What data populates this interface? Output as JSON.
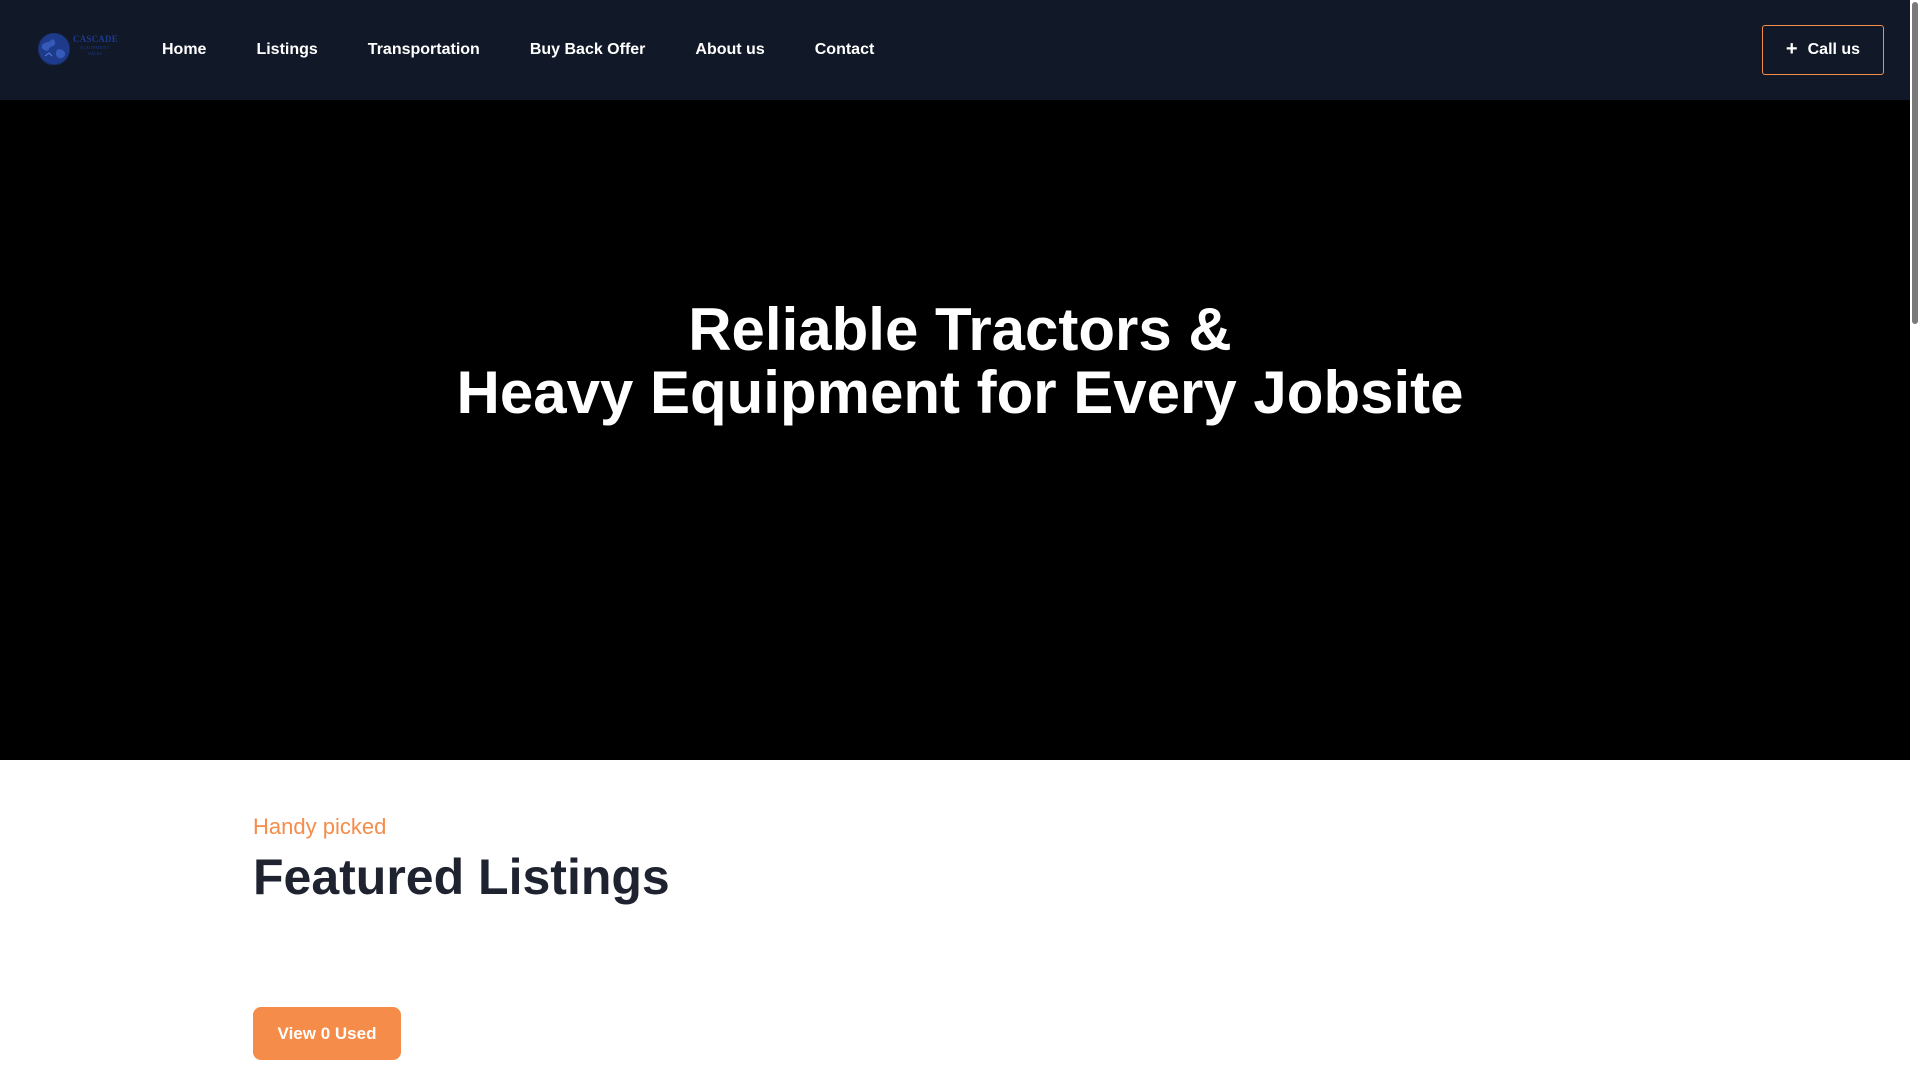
{
  "nav": {
    "logo": {
      "line1": "CASCADE",
      "line2": "EQUIPMENT",
      "line3": "SALES"
    },
    "links": [
      "Home",
      "Listings",
      "Transportation",
      "Buy Back Offer",
      "About us",
      "Contact"
    ],
    "call_button": {
      "icon": "plus-icon",
      "label": "Call us"
    }
  },
  "hero": {
    "title_line1": "Reliable Tractors &",
    "title_line2": "Heavy Equipment for Every Jobsite"
  },
  "featured": {
    "eyebrow": "Handy picked",
    "title": "Featured Listings",
    "view_button": "View 0 Used"
  },
  "colors": {
    "nav_bg": "#111827",
    "hero_bg": "#000000",
    "accent": "#f58c4a",
    "heading": "#1f2330"
  },
  "scrollbar": {
    "visible": true
  }
}
